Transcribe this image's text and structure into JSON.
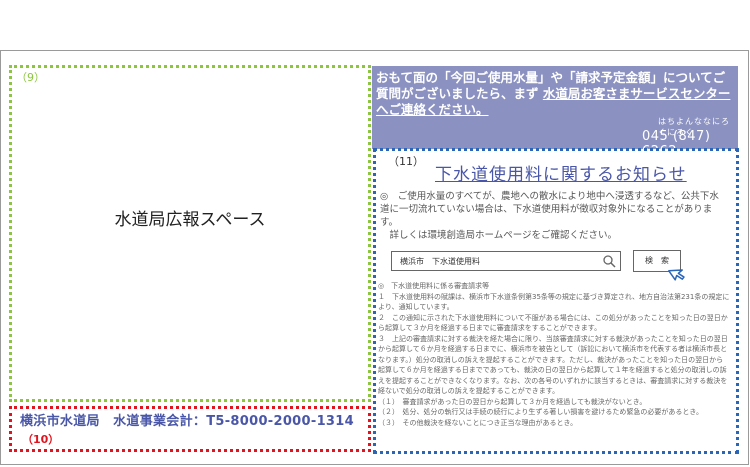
{
  "box9": {
    "number": "（9）",
    "text": "水道局広報スペース"
  },
  "box10": {
    "account": "横浜市水道局　水道事業会計：T5-8000-2000-1314",
    "number": "（10）"
  },
  "banner": {
    "line1": "おもて面の「今回ご使用水量」や「請求予定金額」についてご",
    "line2a": "質問がございましたら、まず ",
    "line2b": "水道局お客さまサービスセンター",
    "line3": "へご連絡ください。",
    "ruby": "はちよんななにろくにろく",
    "phone": "045 (847) 6262"
  },
  "box11": {
    "number": "（11）",
    "title": "下水道使用料に関するお知らせ",
    "intro1": "◎　ご使用水量のすべてが、農地への散水により地中へ浸透するなど、公共下水道に一切流れていない場合は、下水道使用料が徴収対象外になることがあります。",
    "intro2": "　詳しくは環境創造局ホームページをご確認ください。",
    "search_value": "横浜市　下水道使用料",
    "search_button": "検　索",
    "rights_heading": "◎　下水道使用料に係る審査請求等",
    "rights": [
      "１　下水道使用料の賦課は、横浜市下水道条例第35条等の規定に基づき算定され、地方自治法第231条の規定により、通知しています。",
      "２　この通知に示された下水道使用料について不服がある場合には、この処分があったことを知った日の翌日から起算して３か月を経過する日までに審査請求をすることができます。",
      "３　上記の審査請求に対する裁決を経た場合に限り、当該審査請求に対する裁決があったことを知った日の翌日から起算して６か月を経過する日までに、横浜市を被告として（訴訟において横浜市を代表する者は横浜市長となります。）処分の取消しの訴えを提起することができます。ただし、裁決があったことを知った日の翌日から起算して６か月を経過する日までであっても、裁決の日の翌日から起算して１年を経過すると処分の取消しの訴えを提起することができなくなります。なお、次の各号のいずれかに該当するときは、審査請求に対する裁決を経ないで処分の取消しの訴えを提起することができます。",
      "（１）　審査請求があった日の翌日から起算して３か月を経過しても裁決がないとき。",
      "（２）　処分、処分の執行又は手続の続行により生ずる著しい損害を避けるため緊急の必要があるとき。",
      "（３）　その他裁決を経ないことにつき正当な理由があるとき。"
    ]
  },
  "colors": {
    "green_border": "#8cc63f",
    "red_border": "#e0141e",
    "blue_border": "#2b65b8",
    "banner_bg": "#8b92c1",
    "title_text": "#4a57a8"
  }
}
